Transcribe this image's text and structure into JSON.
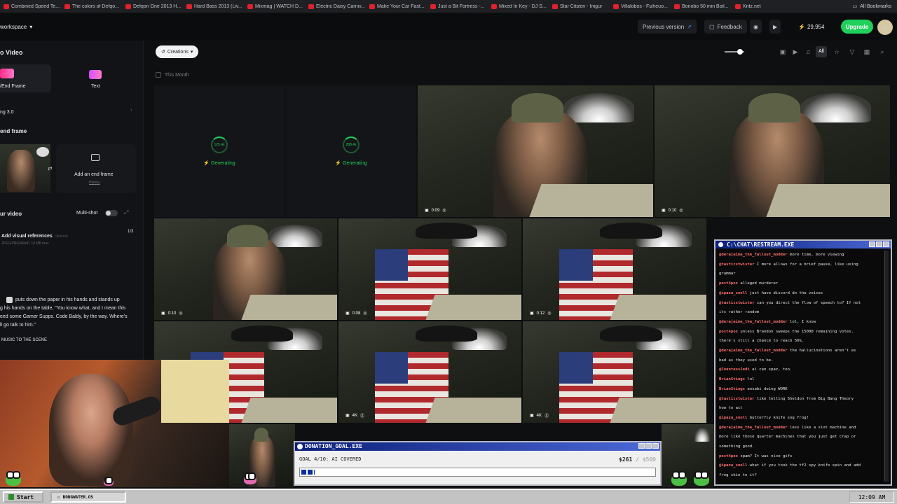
{
  "bookmarks": [
    "Combined Speed Te...",
    "The colors of Defqo...",
    "Defqon One 2013 H...",
    "Hard Bass 2013 (Liv...",
    "Mixmag | WATCH D...",
    "Electric Daisy Carniv...",
    "Make Your Car Fast...",
    "Just a Bit Fortress -...",
    "Mixed In Key - DJ S...",
    "Star Citizen - Imgur",
    "Villalobos - Fizheuo...",
    "Bonobo 50 min Boil...",
    "Kritz.net"
  ],
  "all_bookmarks": "All Bookmarks",
  "topbar": {
    "workspace": "workspace",
    "previous_version": "Previous version",
    "feedback": "Feedback",
    "credits": "29,954",
    "upgrade": "Upgrade"
  },
  "left": {
    "section_title": "o Video",
    "mode_frame": "/End Frame",
    "mode_text": "Text",
    "model": "ng 3.0",
    "frame_heading": "end frame",
    "add_end_frame": "Add an end frame",
    "history": "History",
    "your_video": "ur video",
    "multishot": "Multi-shot",
    "add_visual_refs": "Add visual references",
    "optional": "Optional",
    "refs_count": "1/3",
    "refs_formats": "JPEG/PNG/WebP, 10 MB max",
    "prompt_l1": "puts down the paper in his hands and stands up",
    "prompt_l2": "g his hands on the table, \"You know what, and I mean this",
    "prompt_l3": "eed some Gamer Supps. Code Baldy, by the way. Where's",
    "prompt_l4": "ll go talk to him.\"",
    "music": "MUSIC TO THE SCENE"
  },
  "main": {
    "creations": "Creations",
    "this_month": "This Month",
    "filter_all": "All",
    "gen1_time": "125.4s",
    "gen2_time": "288.4s",
    "generating": "Generating",
    "videos": [
      {
        "duration": "0:09"
      },
      {
        "duration": "0:10"
      },
      {
        "duration": "0:10"
      },
      {
        "duration": "0:08"
      },
      {
        "duration": "0:12"
      },
      {
        "duration": "4K"
      },
      {
        "duration": "4K"
      }
    ]
  },
  "chat": {
    "title": "C:\\CHAT\\RESTREAM.EXE",
    "messages": [
      {
        "user": "@derajaime_the_fallout_modder",
        "text": "more time, more viewing"
      },
      {
        "user": "@tasticstwister",
        "text": "I more allows for a brief pause, like using"
      },
      {
        "user": "",
        "text": "grammar"
      },
      {
        "user": "post4pox",
        "text": "alleged murderer"
      },
      {
        "user": "@ipaza_snoll",
        "text": "just have discord do the voices"
      },
      {
        "user": "@tasticstwister",
        "text": "can you direct the flow of speech to? If not"
      },
      {
        "user": "",
        "text": "its rather random"
      },
      {
        "user": "@derajaime_the_fallout_modder",
        "text": "lol, I know"
      },
      {
        "user": "post4pox",
        "text": "unless Brandon sweeps the 15000 remaining votes."
      },
      {
        "user": "",
        "text": "there's still a chance to reach 56%."
      },
      {
        "user": "@derajaime_the_fallout_modder",
        "text": "the hallucinations aren't as"
      },
      {
        "user": "",
        "text": "bad as they used to be."
      },
      {
        "user": "@CountessJedi",
        "text": "ai can spaz, too."
      },
      {
        "user": "BrianStings",
        "text": "lol"
      },
      {
        "user": "BrianStings",
        "text": "aosabi doing WORK"
      },
      {
        "user": "@tasticstwister",
        "text": "like telling Sheldon from Big Bang Theory"
      },
      {
        "user": "",
        "text": "how to act"
      },
      {
        "user": "@ipaza_snoll",
        "text": "butterfly knife sog frog!"
      },
      {
        "user": "@derajaime_the_fallout_modder",
        "text": "less like a slot machine and"
      },
      {
        "user": "",
        "text": "more like those quarter machines that you just get crap or"
      },
      {
        "user": "",
        "text": "something good."
      },
      {
        "user": "post4pox",
        "text": "spam? It was nice gifs"
      },
      {
        "user": "@ipaza_snoll",
        "text": "what if you took the tf2 spy knife spin and add"
      },
      {
        "user": "",
        "text": "frog skin to it?"
      }
    ]
  },
  "donation": {
    "title": "DONATION_GOAL.EXE",
    "goal": "GOAL 4/10: AI COVERED",
    "raised": "$261",
    "target": "/ $500",
    "progress": 0.038
  },
  "taskbar": {
    "start": "Start",
    "task": "BONGWATER.OS",
    "clock": "12:09 AM"
  }
}
